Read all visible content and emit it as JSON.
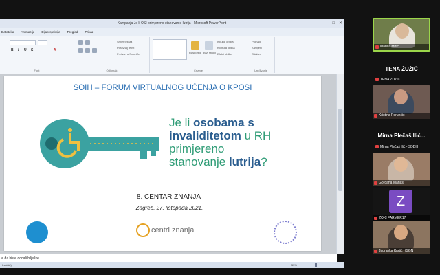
{
  "ppt": {
    "window_title": "Kampanja Je li OSI primjereno stanovanje lutrija  -  Microsoft PowerPoint",
    "win_controls": [
      "–",
      "□",
      "✕"
    ],
    "menu": [
      "Datoteka",
      "Animacije",
      "Dijaprojekcija",
      "Pregled",
      "Prikaz"
    ],
    "ribbon": {
      "font_label": "Font",
      "paragraph_label": "Odlomak",
      "drawing_label": "Crtanje",
      "editing_label": "Uređivanje",
      "text_direction": "Smjer teksta",
      "align_text": "Poravnaj tekst",
      "convert_smartart": "Pretvori u SmartArt",
      "arrange": "Rasporedi",
      "quick_styles": "Brzi stilovi",
      "shape_fill": "Ispuna oblika",
      "shape_outline": "Kontura oblika",
      "shape_effects": "Efekti oblika",
      "find": "Pronađi",
      "replace": "Zamijeni",
      "select": "Odaberi"
    },
    "slide": {
      "header": "SOIH – FORUM VIRTUALNOG UČENJA O KPOSI",
      "q_line1_a": "Je li ",
      "q_line1_b": "osobama s",
      "q_line2_a": "invaliditetom",
      "q_line2_b": " u RH",
      "q_line3": "primjereno",
      "q_line4_a": "stanovanje ",
      "q_line4_b": "lutrija",
      "q_line4_c": "?",
      "centar": "8. CENTAR ZNANJA",
      "datum": "Zagreb, 27. listopada 2021.",
      "logo_centri": "centri znanja"
    },
    "notes_placeholder": "te da biste dodali bilješke",
    "status_text": "Hrvatski)",
    "zoom": "55%"
  },
  "participants": [
    {
      "tile_name": "Marica Mirić",
      "color": "#7a8a4a"
    },
    {
      "heading": "TENA ŽUŽIĆ",
      "sub": "TENA ŽUŽIĆ"
    },
    {
      "tile_name": "Kristina Perunčić",
      "color": "#8a6a5a"
    },
    {
      "heading": "Mirna Plečaš Ilić...",
      "sub": "Mirna Plečaš Ilić - SDDH"
    },
    {
      "tile_name": "Gordana Mariąs",
      "color": "#b08a70"
    },
    {
      "tile_name": "ZOKI FARMER17",
      "initial": "Z",
      "color": "#7a4cc2"
    },
    {
      "tile_name": "Jadranka Krstić HSGN",
      "color": "#a88a6a"
    }
  ],
  "colors": {
    "slide_blue": "#2b6fb3",
    "slide_green": "#2f9c76",
    "key_teal": "#3ba2a1",
    "mic_red": "#e04040"
  }
}
